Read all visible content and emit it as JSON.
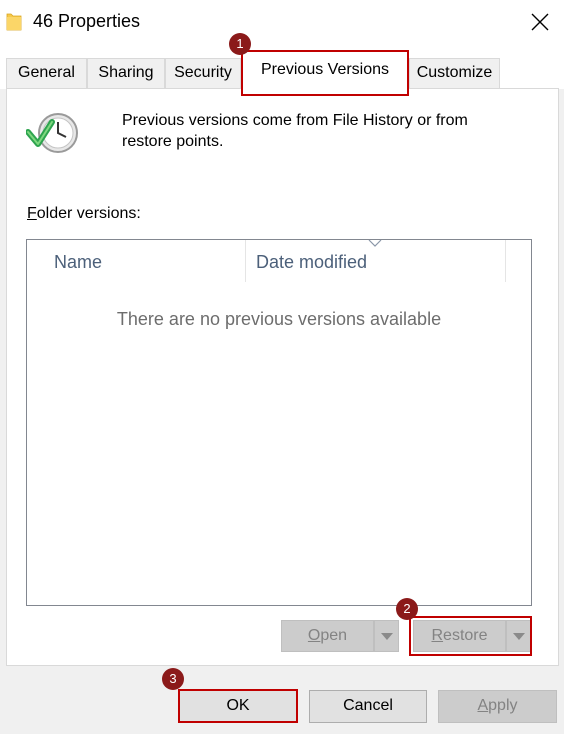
{
  "window": {
    "title": "46 Properties",
    "close_glyph": "✕"
  },
  "tabs": [
    {
      "label": "General",
      "selected": false
    },
    {
      "label": "Sharing",
      "selected": false
    },
    {
      "label": "Security",
      "selected": false
    },
    {
      "label": "Previous Versions",
      "selected": true
    },
    {
      "label": "Customize",
      "selected": false
    }
  ],
  "panel": {
    "description": "Previous versions come from File History or from restore points.",
    "folder_label_first": "F",
    "folder_label_rest": "older versions:",
    "columns": [
      "Name",
      "Date modified"
    ],
    "empty_message": "There are no previous versions available",
    "sort_icon": "chevron-down-icon"
  },
  "buttons": {
    "open_first": "O",
    "open_rest": "pen",
    "restore_first": "R",
    "restore_rest": "estore",
    "ok": "OK",
    "cancel": "Cancel",
    "apply_first": "A",
    "apply_rest": "pply"
  },
  "markers": [
    "1",
    "2",
    "3"
  ],
  "colors": {
    "highlight": "#c00000",
    "marker": "#8b1a1a",
    "header_text": "#4c607a"
  }
}
